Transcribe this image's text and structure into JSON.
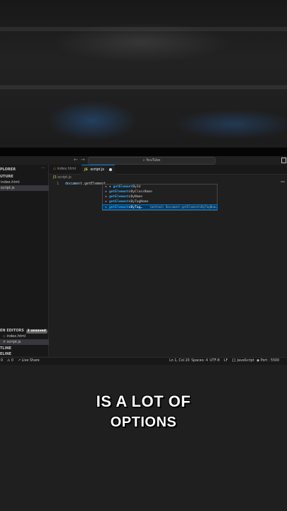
{
  "titlebar": {
    "back_glyph": "←",
    "forward_glyph": "→",
    "search_text": "YouTube",
    "search_icon": "search-icon",
    "layout_icon": "layout-icon"
  },
  "sidebar": {
    "header": "PLORER",
    "more": "···",
    "folder": "UTURE",
    "files": [
      "index.html",
      "script.js"
    ],
    "open_editors": "EN EDITORS",
    "unsaved_badge": "1 unsaved",
    "open_files": [
      "index.html",
      "script.js"
    ],
    "outline": "TLINE",
    "timeline": "ELINE"
  },
  "tabs": [
    {
      "label": "index.html",
      "icon": "html-file-icon"
    },
    {
      "label": "script.js",
      "icon": "js-file-icon",
      "jsmark": "JS"
    }
  ],
  "editor": {
    "breadcrumb": "script.js",
    "line_number": "1",
    "code_object": "document.",
    "code_partial": "getElement"
  },
  "suggestions": [
    {
      "match": "getElement",
      "rest": "ById",
      "star": "★ "
    },
    {
      "match": "getElement",
      "rest": "sByClassName"
    },
    {
      "match": "getElement",
      "rest": "sByName"
    },
    {
      "match": "getElement",
      "rest": "sByTagName"
    },
    {
      "match": "getElement",
      "rest": "sByTag…",
      "desc": "(method) Document.getElementsByTagNam…"
    }
  ],
  "statusbar": {
    "errors": "0",
    "warnings": "0",
    "liveshare": "Live Share",
    "position": "Ln 1, Col 20",
    "spaces": "Spaces: 4",
    "encoding": "UTF-8",
    "eol": "LF",
    "language": "JavaScript",
    "port": "Port : 5500"
  },
  "caption": {
    "line1": "is a lot of",
    "line2": "options"
  },
  "colors": {
    "accent": "#0078d4",
    "match": "#2aaaff",
    "selected_bg": "#04395e"
  }
}
